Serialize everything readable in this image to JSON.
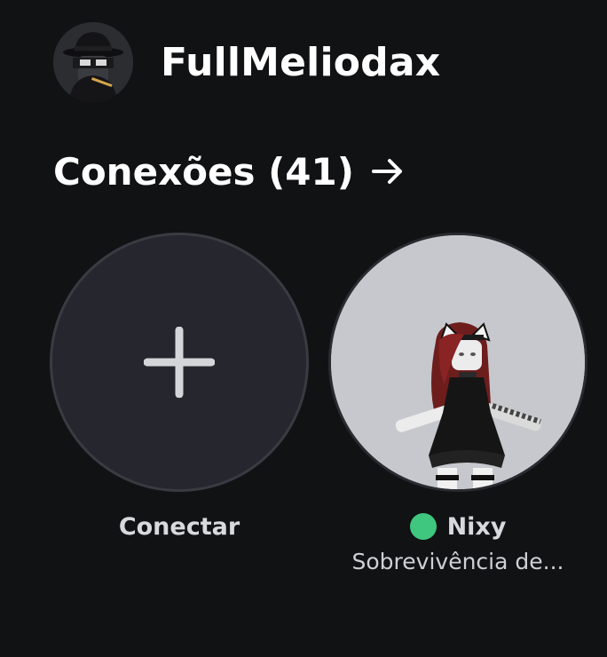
{
  "profile": {
    "username": "FullMeliodax",
    "avatar_icon": "avatar-thumbnail"
  },
  "connections": {
    "title": "Conexões (41)",
    "arrow_icon": "arrow-right-icon"
  },
  "tiles": [
    {
      "label": "Conectar",
      "icon": "plus-icon"
    },
    {
      "name": "Nixy",
      "status": "online",
      "status_color": "#3fc77f",
      "activity": "Sobrevivência de..."
    }
  ],
  "colors": {
    "background": "#111214",
    "tile_background": "#26272e",
    "online": "#3fc77f"
  }
}
